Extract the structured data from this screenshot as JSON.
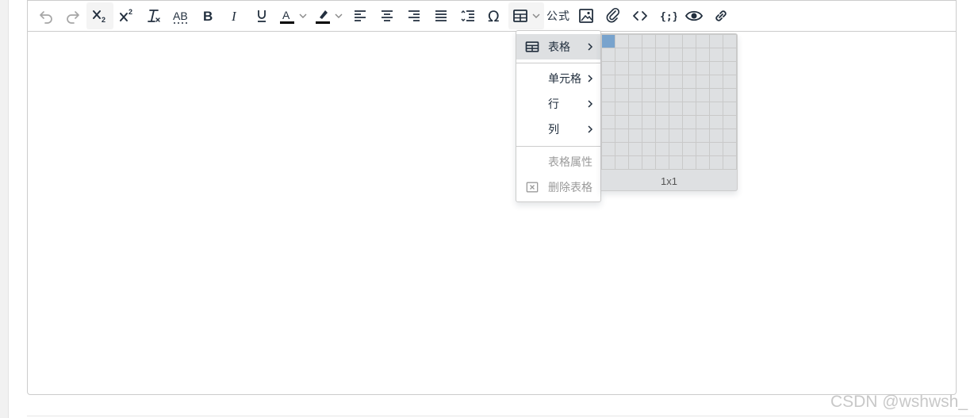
{
  "toolbar": {
    "formula_label": "公式",
    "buttons": [
      "undo-icon",
      "redo-icon",
      "subscript-icon",
      "superscript-icon",
      "remove-format-icon",
      "spellcheck-icon",
      "bold-icon",
      "italic-icon",
      "underline-icon",
      "text-color-icon",
      "highlight-color-icon",
      "align-left-icon",
      "align-center-icon",
      "align-right-icon",
      "align-justify-icon",
      "line-height-icon",
      "omega-icon",
      "table-icon",
      "image-icon",
      "attachment-icon",
      "code-icon",
      "codesample-icon",
      "preview-icon",
      "link-icon"
    ]
  },
  "table_menu": {
    "items": [
      {
        "label": "表格",
        "icon": "table-icon",
        "submenu": true,
        "highlighted": true
      },
      {
        "label": "单元格",
        "submenu": true
      },
      {
        "label": "行",
        "submenu": true
      },
      {
        "label": "列",
        "submenu": true
      },
      {
        "label": "表格属性",
        "disabled": true
      },
      {
        "label": "删除表格",
        "icon": "delete-table-icon",
        "disabled": true
      }
    ]
  },
  "table_grid": {
    "columns": 10,
    "rows": 10,
    "selected_columns": 1,
    "selected_rows": 1,
    "size_label": "1x1",
    "colors": {
      "cell": "#dee0e2",
      "border": "#c9c9c9",
      "selected": "#78a3cd"
    }
  },
  "watermark": "CSDN @wshwsh_"
}
